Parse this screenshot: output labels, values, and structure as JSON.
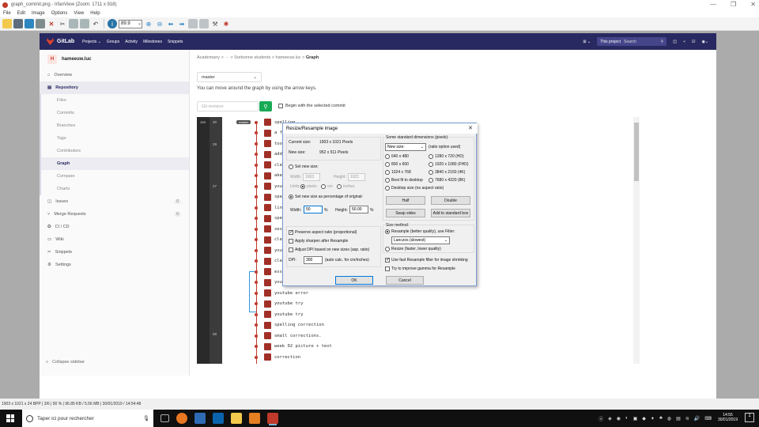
{
  "window": {
    "title": "graph_commit.png - IrfanView (Zoom: 1711 x 918)",
    "controls": [
      "—",
      "❐",
      "✕"
    ]
  },
  "menu": [
    "File",
    "Edit",
    "Image",
    "Options",
    "View",
    "Help"
  ],
  "toolbar": {
    "zoom_value": "89.9"
  },
  "gitlab": {
    "brand": "GitLab",
    "nav": [
      "Projects ⌄",
      "Groups",
      "Activity",
      "Milestones",
      "Snippets"
    ],
    "search_scope": "This project",
    "search_placeholder": "Search",
    "project_initial": "H",
    "project_name": "hameeuw.luc"
  },
  "sidebar": {
    "overview": "Overview",
    "repository": "Repository",
    "sub": [
      "Files",
      "Commits",
      "Branches",
      "Tags",
      "Contributors",
      "Graph",
      "Compare",
      "Charts"
    ],
    "issues": "Issues",
    "issues_count": "0",
    "merge_requests": "Merge Requests",
    "mr_count": "0",
    "cicd": "CI / CD",
    "wiki": "Wiki",
    "snippets": "Snippets",
    "settings": "Settings",
    "collapse": "Collapse sidebar"
  },
  "breadcrumb": {
    "path": "Academany > ··· > Sorbonne students > hameeuw.luc >",
    "current": "Graph"
  },
  "branch": "master",
  "hint": "You can move around the graph by using the arrow keys.",
  "revision_placeholder": "Git revision",
  "begin_label": "Begin with the selected commit",
  "graph": {
    "month": "Jan",
    "days": [
      "30",
      "29",
      "27",
      "08"
    ],
    "branch_tag": "master",
    "commits": [
      "spelling",
      "a f",
      "too",
      "add",
      "cle",
      "ake",
      "you",
      "spe",
      "lin",
      "spe",
      "ses",
      "cle",
      "you",
      "cle",
      "ess",
      "you",
      "youtube error",
      "youtube try",
      "youtube try",
      "spelling correction",
      "small corrections.",
      "week 02 picture + text",
      "correction"
    ]
  },
  "dialog": {
    "title": "Resize/Resample image",
    "current_size_label": "Current size:",
    "current_size": "1903  x  1021  Pixels",
    "new_size_label": "New size:",
    "new_size": "952  x  511  Pixels",
    "set_new_size": "Set new size:",
    "width_label": "Width:",
    "width_val": "1903",
    "height_label": "Height:",
    "height_val": "1021",
    "units_label": "Units:",
    "units": [
      "pixels",
      "cm",
      "inches"
    ],
    "set_percentage": "Set new size as percentage of original:",
    "pct_width_label": "Width:",
    "pct_width": "50",
    "pct_height_label": "Height:",
    "pct_height": "50.00",
    "pct_sign": "%",
    "preserve": "Preserve aspect ratio (proportional)",
    "sharpen": "Apply sharpen after Resample",
    "adjust_dpi": "Adjust DPI based on new sizes (asp. ratio)",
    "dpi_label": "DPI:",
    "dpi_val": "300",
    "dpi_note": "(auto calc. for cm/inches)",
    "ok": "OK",
    "cancel": "Cancel",
    "std_label": "Some standard dimensions (pixels):",
    "std_select": "New size:",
    "std_note": "(ratio option used)",
    "std_left": [
      "640 x 480",
      "800 x 600",
      "1024 x 768",
      "Best fit to desktop",
      "Desktop size (no aspect ratio)"
    ],
    "std_right": [
      "1280 x 720  (HD)",
      "1920 x 1080 (FHD)",
      "3840 x 2160 (4K)",
      "7680 x 4320 (8K)"
    ],
    "half": "Half",
    "double": "Double",
    "swap": "Swap sides",
    "add_std": "Add to standard box",
    "method_label": "Size method:",
    "resample": "Resample (better quality), use Filter:",
    "filter": "Lanczos (slowest)",
    "resize": "Resize (faster, lower quality)",
    "fast_filter": "Use fast Resample filter for image shrinking",
    "gamma": "Try to improve gamma for Resample"
  },
  "status": "1903 x 1021 x 24 BPP  |  3/6  |  90 %  |  96.85 KB / 5.56 MB  |  30/01/2019 / 14:54:48",
  "taskbar": {
    "search": "Taper ici pour rechercher",
    "time": "14:55",
    "date": "30/01/2019",
    "notif": "1"
  }
}
